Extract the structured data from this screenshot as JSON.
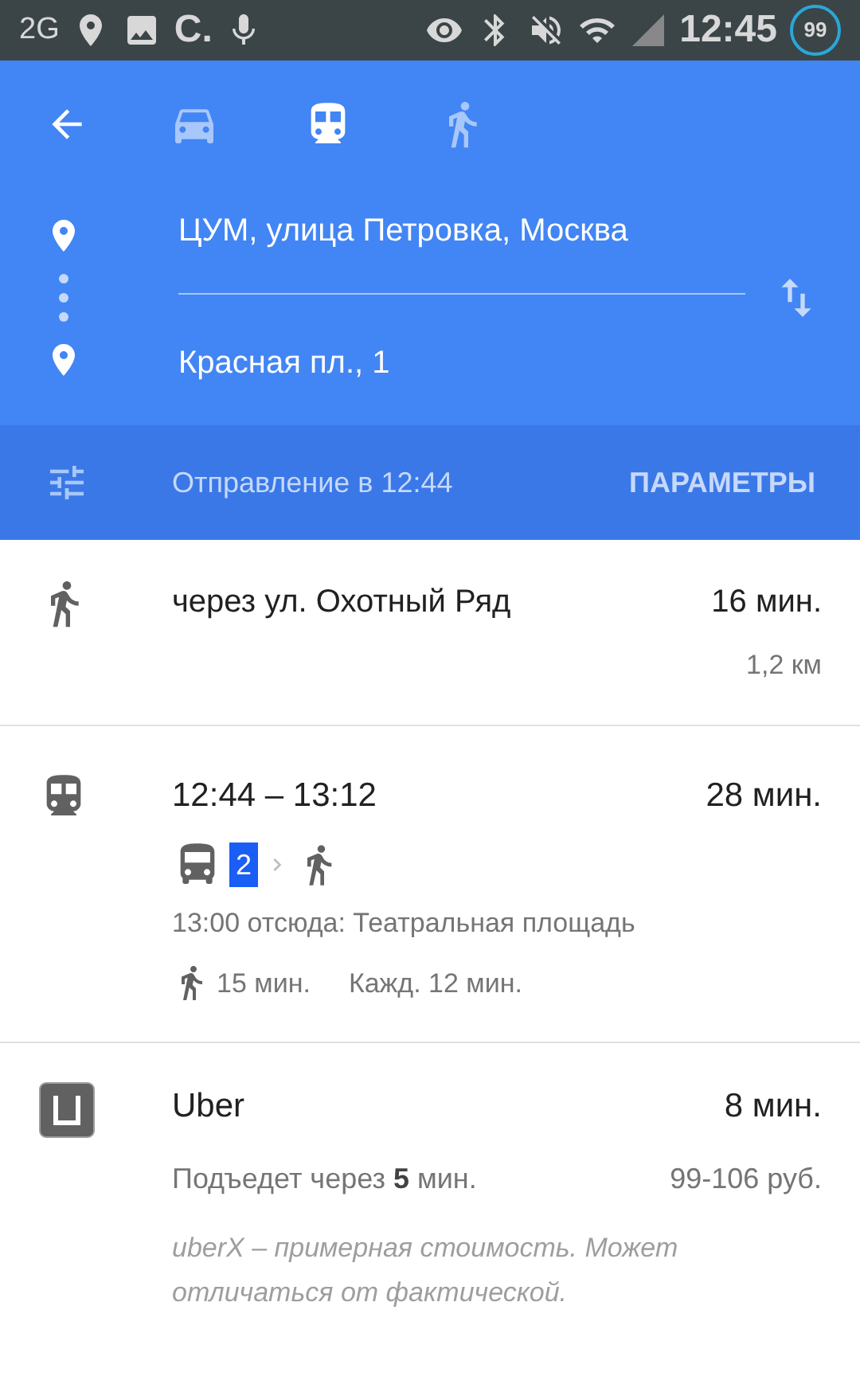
{
  "status_bar": {
    "network": "2G",
    "carrier": "C.",
    "time": "12:45",
    "battery": "99"
  },
  "modes": [
    {
      "kind": "car",
      "selected": false
    },
    {
      "kind": "transit",
      "selected": true
    },
    {
      "kind": "walk",
      "selected": false
    }
  ],
  "route": {
    "origin": "ЦУМ, улица Петровка, Москва",
    "destination": "Красная пл., 1"
  },
  "options_bar": {
    "departure": "Отправление в 12:44",
    "button": "ПАРАМЕТРЫ"
  },
  "results": [
    {
      "kind": "walk",
      "title": "через ул.  Охотный Ряд",
      "duration": "16 мин.",
      "distance": "1,2 км"
    },
    {
      "kind": "transit",
      "title": "12:44 – 13:12",
      "duration": "28 мин.",
      "line": "2",
      "stop": "13:00 отсюда: Театральная площадь",
      "walk": "15 мин.",
      "frequency": "Кажд. 12 мин."
    },
    {
      "kind": "ride",
      "title": "Uber",
      "duration": "8 мин.",
      "pickup": "Подъедет через **5** мин.",
      "price": "99-106 руб.",
      "note": "uberX – примерная стоимость. Может отличаться от фактической."
    }
  ]
}
